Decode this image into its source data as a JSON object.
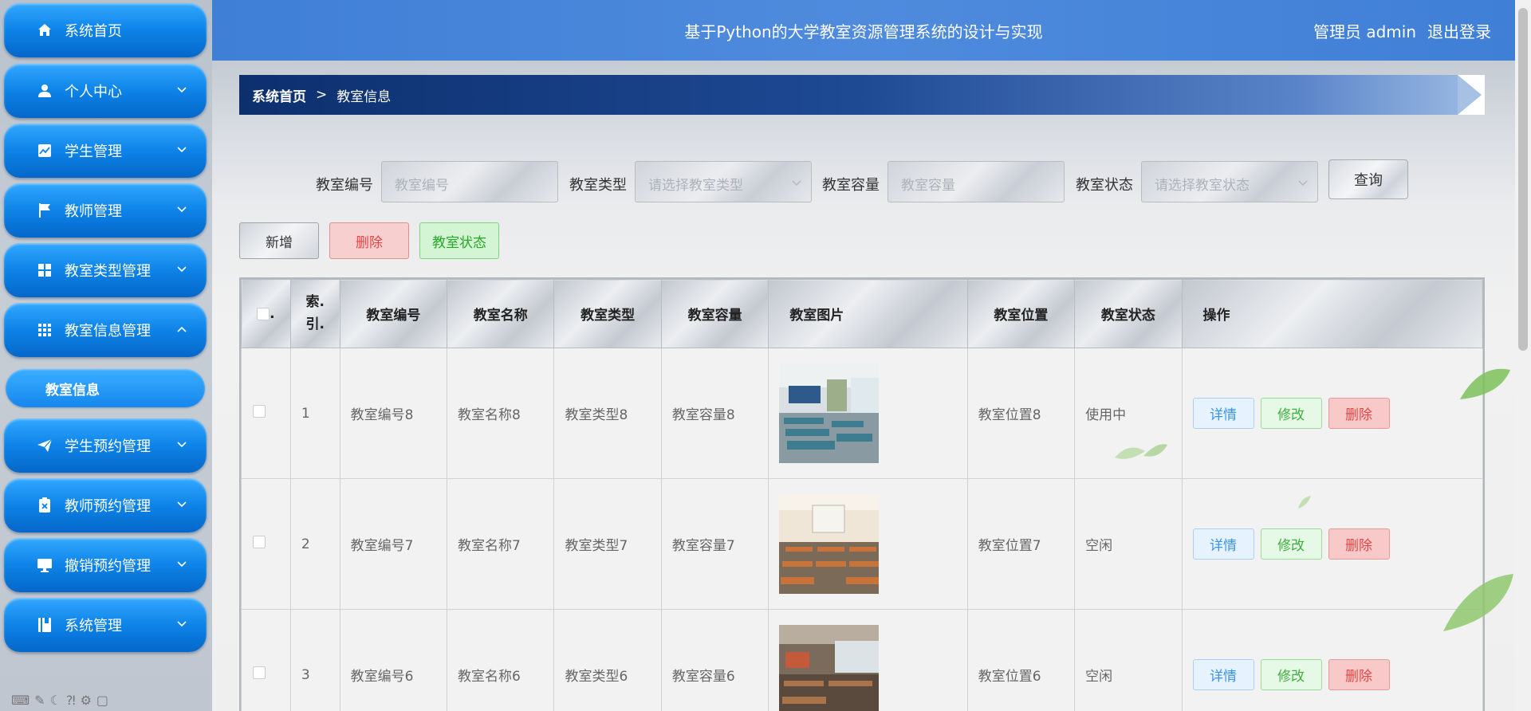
{
  "sidebar": {
    "items": [
      {
        "label": "系统首页",
        "icon": "home-icon",
        "has_arrow": false
      },
      {
        "label": "个人中心",
        "icon": "user-icon",
        "has_arrow": true
      },
      {
        "label": "学生管理",
        "icon": "chart-icon",
        "has_arrow": true
      },
      {
        "label": "教师管理",
        "icon": "flag-icon",
        "has_arrow": true
      },
      {
        "label": "教室类型管理",
        "icon": "grid-icon",
        "has_arrow": true
      },
      {
        "label": "教室信息管理",
        "icon": "apps-icon",
        "has_arrow": true,
        "expanded": true
      },
      {
        "label": "学生预约管理",
        "icon": "send-icon",
        "has_arrow": true
      },
      {
        "label": "教师预约管理",
        "icon": "clipboard-x-icon",
        "has_arrow": true
      },
      {
        "label": "撤销预约管理",
        "icon": "monitor-icon",
        "has_arrow": true
      },
      {
        "label": "系统管理",
        "icon": "book-icon",
        "has_arrow": true
      }
    ],
    "submenu": {
      "label": "教室信息"
    }
  },
  "header": {
    "title": "基于Python的大学教室资源管理系统的设计与实现",
    "user_label": "管理员 admin",
    "logout_label": "退出登录"
  },
  "breadcrumb": {
    "home": "系统首页",
    "separator": ">",
    "current": "教室信息"
  },
  "search": {
    "fields": [
      {
        "label": "教室编号",
        "placeholder": "教室编号",
        "type": "input"
      },
      {
        "label": "教室类型",
        "placeholder": "请选择教室类型",
        "type": "select"
      },
      {
        "label": "教室容量",
        "placeholder": "教室容量",
        "type": "input"
      },
      {
        "label": "教室状态",
        "placeholder": "请选择教室状态",
        "type": "select"
      }
    ],
    "query_label": "查询"
  },
  "actions": {
    "add_label": "新增",
    "delete_label": "删除",
    "status_label": "教室状态"
  },
  "table": {
    "headers": [
      "索引",
      "教室编号",
      "教室名称",
      "教室类型",
      "教室容量",
      "教室图片",
      "教室位置",
      "教室状态",
      "操作"
    ],
    "index_header_line1": "索.",
    "index_header_line2": "引.",
    "checkbox_header_suffix": ".",
    "rows": [
      {
        "index": "1",
        "code": "教室编号8",
        "name": "教室名称8",
        "type": "教室类型8",
        "capacity": "教室容量8",
        "location": "教室位置8",
        "status": "使用中"
      },
      {
        "index": "2",
        "code": "教室编号7",
        "name": "教室名称7",
        "type": "教室类型7",
        "capacity": "教室容量7",
        "location": "教室位置7",
        "status": "空闲"
      },
      {
        "index": "3",
        "code": "教室编号6",
        "name": "教室名称6",
        "type": "教室类型6",
        "capacity": "教室容量6",
        "location": "教室位置6",
        "status": "空闲"
      }
    ],
    "op_labels": {
      "detail": "详情",
      "edit": "修改",
      "delete": "删除"
    }
  },
  "colors": {
    "header_blue": "#4381d8",
    "menu_blue": "#0d83e8",
    "breadcrumb_navy": "#0d2f6e",
    "danger": "#e24848",
    "success": "#27a827",
    "info": "#3c95eb"
  }
}
